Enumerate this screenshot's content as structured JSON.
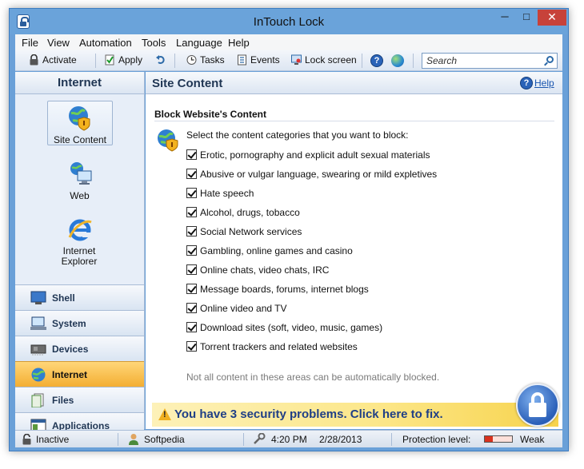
{
  "window": {
    "title": "InTouch Lock",
    "minimize": "─",
    "maximize": "□",
    "close": "✕"
  },
  "menu": [
    "File",
    "View",
    "Automation",
    "Tools",
    "Language",
    "Help"
  ],
  "toolbar": {
    "activate": "Activate",
    "apply": "Apply",
    "tasks": "Tasks",
    "events": "Events",
    "lock_screen": "Lock screen",
    "search_placeholder": "Search"
  },
  "sidebar": {
    "header": "Internet",
    "categories": [
      {
        "label": "Site Content",
        "icon": "globe-shield-icon"
      },
      {
        "label": "Web",
        "icon": "computer-globe-icon"
      },
      {
        "label": "Internet Explorer",
        "icon": "internet-explorer-icon"
      }
    ],
    "nav": [
      {
        "label": "Shell",
        "icon": "monitor-icon"
      },
      {
        "label": "System",
        "icon": "computer-icon"
      },
      {
        "label": "Devices",
        "icon": "chip-icon"
      },
      {
        "label": "Internet",
        "icon": "globe-icon",
        "active": true
      },
      {
        "label": "Files",
        "icon": "files-icon"
      },
      {
        "label": "Applications",
        "icon": "application-window-icon"
      }
    ]
  },
  "content": {
    "title": "Site Content",
    "help": "Help",
    "section_title": "Block Website's Content",
    "instructions": "Select the content categories that you want to block:",
    "items": [
      {
        "label": "Erotic, pornography and explicit adult sexual materials",
        "checked": true
      },
      {
        "label": "Abusive or vulgar language, swearing or mild expletives",
        "checked": true
      },
      {
        "label": "Hate speech",
        "checked": true
      },
      {
        "label": "Alcohol, drugs, tobacco",
        "checked": true
      },
      {
        "label": "Social Network services",
        "checked": true
      },
      {
        "label": "Gambling, online games and casino",
        "checked": true
      },
      {
        "label": "Online chats, video chats, IRC",
        "checked": true
      },
      {
        "label": "Message boards, forums, internet blogs",
        "checked": true
      },
      {
        "label": "Online video and TV",
        "checked": true
      },
      {
        "label": "Download sites (soft, video, music, games)",
        "checked": true
      },
      {
        "label": "Torrent trackers and related websites",
        "checked": true
      }
    ],
    "note": "Not all content in these areas can be automatically blocked.",
    "alert": "You have 3 security problems. Click here to fix."
  },
  "status": {
    "state": "Inactive",
    "user": "Softpedia",
    "time": "4:20 PM",
    "date": "2/28/2013",
    "protection_label": "Protection level:",
    "protection_value": "Weak",
    "protection_fraction": 0.3
  },
  "colors": {
    "accent": "#2a63b8",
    "alert": "#f7d34c",
    "active_nav": "#f3ae32",
    "weak": "#d9321e"
  }
}
